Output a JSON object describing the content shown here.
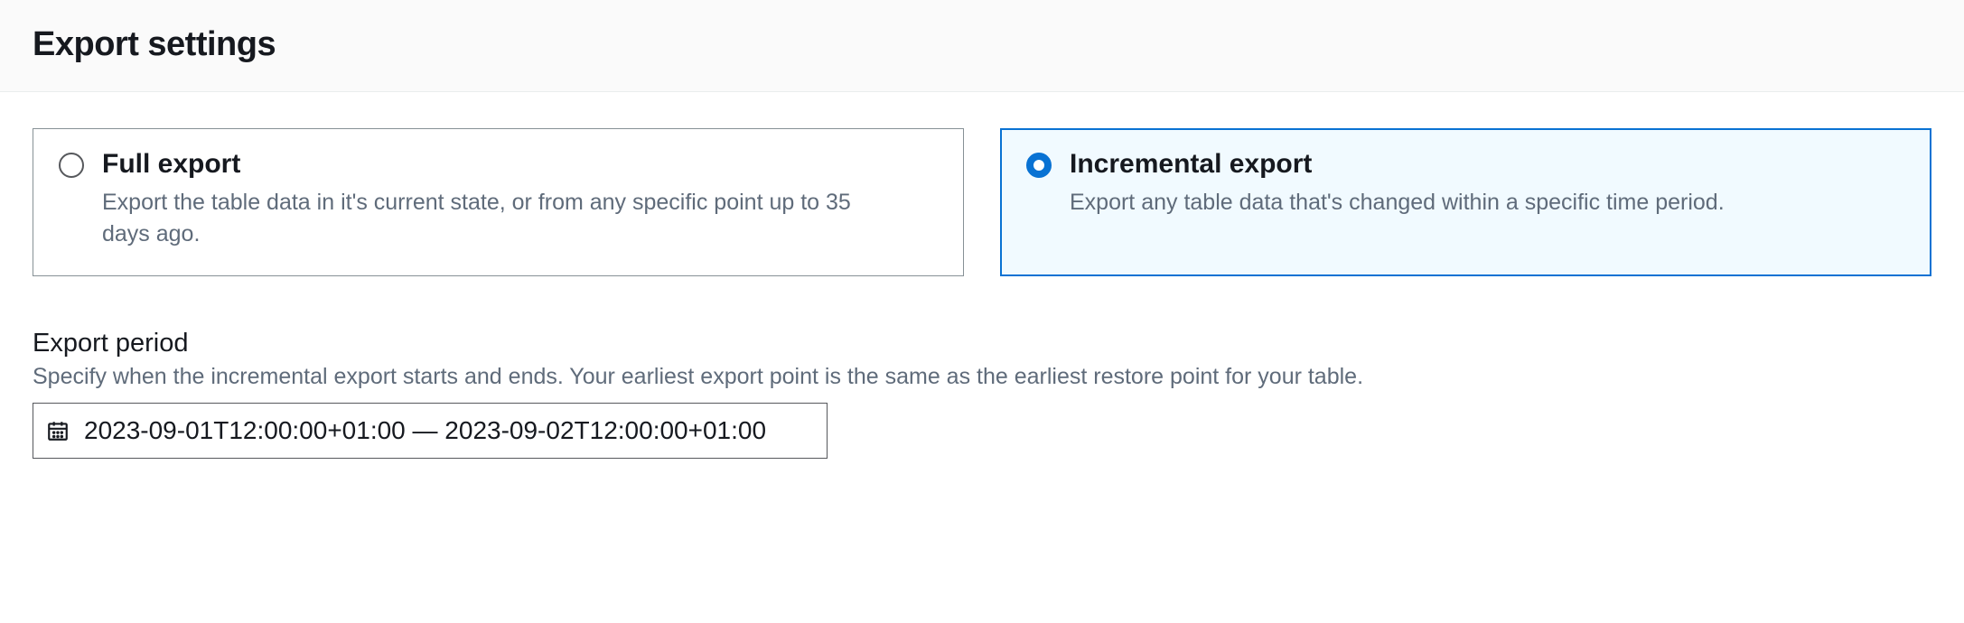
{
  "header": {
    "title": "Export settings"
  },
  "options": {
    "full": {
      "title": "Full export",
      "description": "Export the table data in it's current state, or from any specific point up to 35 days ago.",
      "selected": false
    },
    "incremental": {
      "title": "Incremental export",
      "description": "Export any table data that's changed within a specific time period.",
      "selected": true
    }
  },
  "export_period": {
    "label": "Export period",
    "description": "Specify when the incremental export starts and ends. Your earliest export point is the same as the earliest restore point for your table.",
    "value": "2023-09-01T12:00:00+01:00 — 2023-09-02T12:00:00+01:00"
  }
}
